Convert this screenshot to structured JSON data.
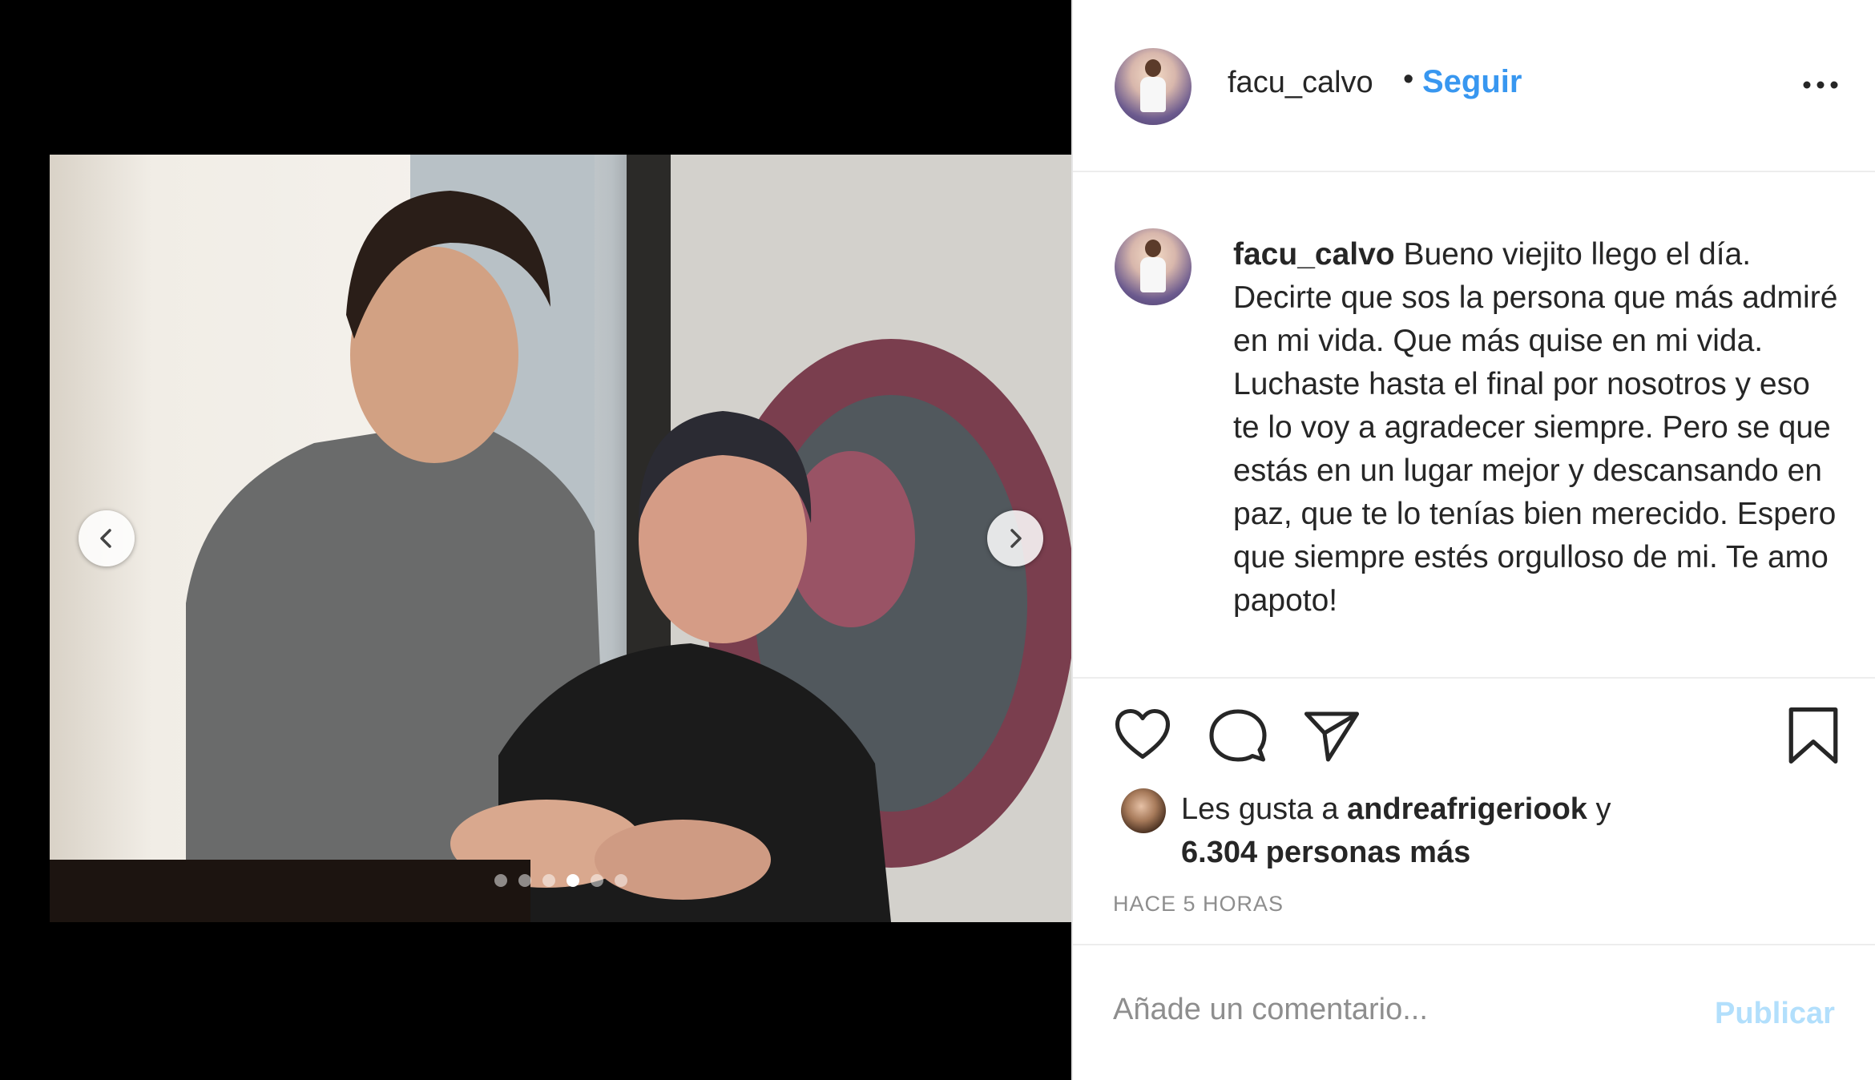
{
  "post": {
    "username": "facu_calvo",
    "separator": "•",
    "follow_label": "Seguir",
    "more_icon": "more-options-icon"
  },
  "media": {
    "image_description": "photo",
    "slide_count": 6,
    "active_slide": 4,
    "prev_icon": "chevron-left-icon",
    "next_icon": "chevron-right-icon"
  },
  "caption": {
    "username": "facu_calvo",
    "text": "Bueno viejito llego el día. Decirte que sos la persona que más admiré en mi vida. Que más quise en mi vida. Luchaste hasta el final por nosotros y eso te lo voy a agradecer siempre. Pero se que estás en un lugar mejor y descansando en paz, que te lo tenías bien merecido. Espero que siempre estés orgulloso de mi. Te amo papoto!"
  },
  "actions": {
    "like_icon": "heart-icon",
    "comment_icon": "comment-icon",
    "share_icon": "share-icon",
    "save_icon": "bookmark-icon"
  },
  "likes": {
    "prefix": "Les gusta a",
    "liked_by": "andreafrigeriook",
    "conjunction": "y",
    "others": "6.304 personas más"
  },
  "timestamp": "HACE 5 HORAS",
  "comment": {
    "placeholder": "Añade un comentario...",
    "publish_label": "Publicar"
  },
  "colors": {
    "link_blue": "#3897f0",
    "publish_disabled": "#b2dffc",
    "text": "#262626",
    "muted": "#8e8e8e"
  }
}
